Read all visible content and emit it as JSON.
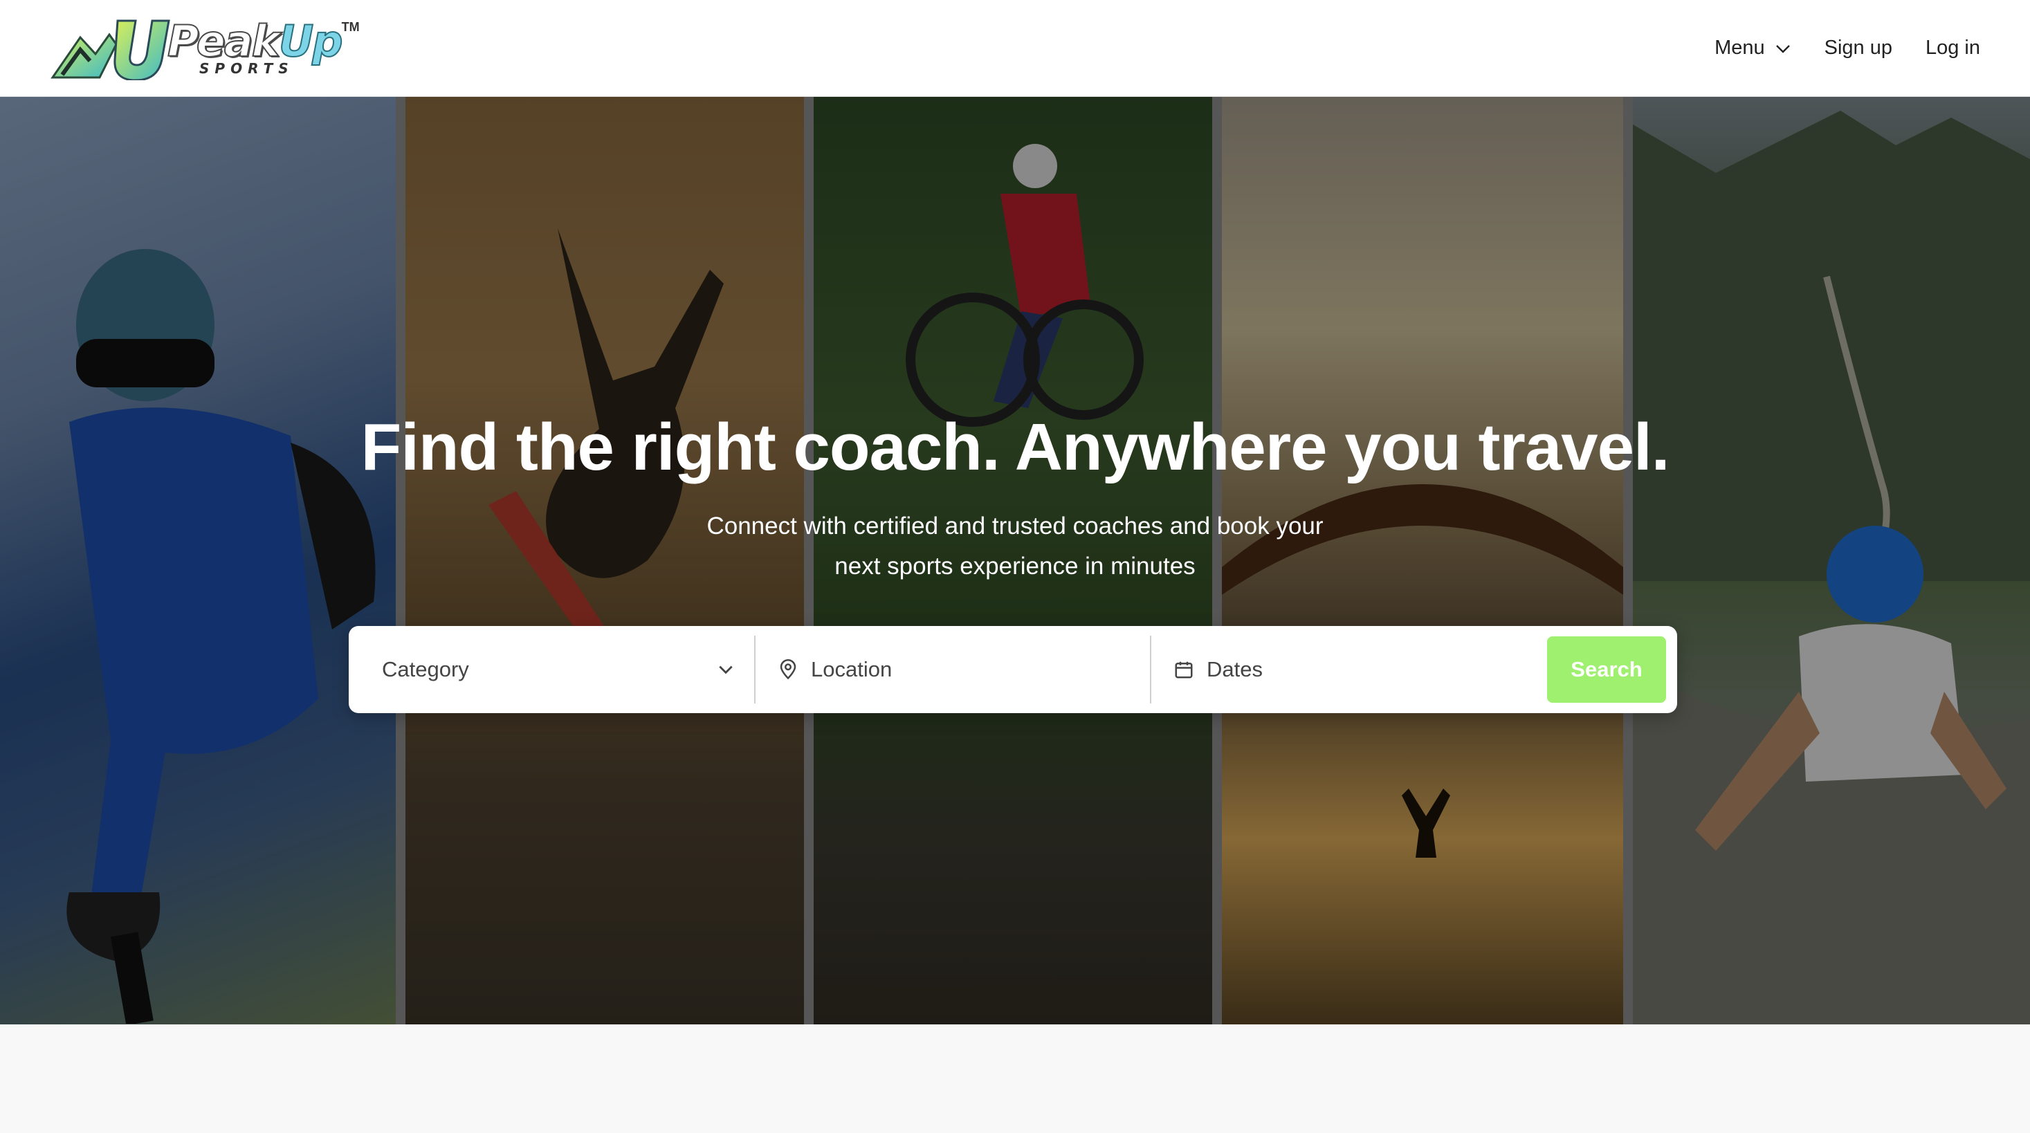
{
  "header": {
    "logo": {
      "word_peak": "Peak",
      "word_up": "Up",
      "sub": "SPORTS",
      "tm": "TM"
    },
    "nav": [
      {
        "label": "Menu",
        "icon": "chevron-down-icon"
      },
      {
        "label": "Sign up"
      },
      {
        "label": "Log in"
      }
    ]
  },
  "hero": {
    "title": "Find the right coach. Anywhere you travel.",
    "subtitle": "Connect with certified and trusted coaches and book your next sports experience in minutes",
    "panels": [
      "skier",
      "kitesurfer",
      "mountain-biker",
      "paraglider",
      "climber"
    ]
  },
  "search": {
    "category_placeholder": "Category",
    "location_placeholder": "Location",
    "dates_placeholder": "Dates",
    "button_label": "Search",
    "button_color": "#9ff06e",
    "icons": [
      "chevron-down-icon",
      "map-pin-icon",
      "calendar-icon"
    ]
  }
}
